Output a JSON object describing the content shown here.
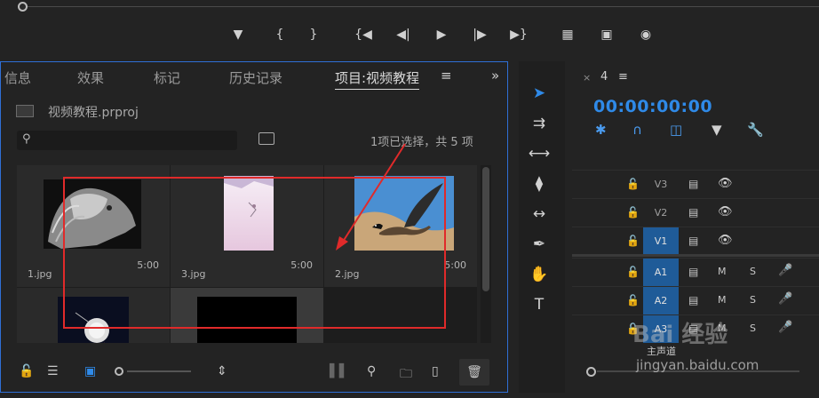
{
  "project_panel": {
    "tabs": [
      {
        "label": "信息"
      },
      {
        "label": "效果"
      },
      {
        "label": "标记"
      },
      {
        "label": "历史记录"
      },
      {
        "label": "项目:视频教程"
      }
    ],
    "project_file": "视频教程.prproj",
    "search_placeholder": "",
    "selection_status": "1项已选择，共 5 项",
    "items": [
      {
        "name": "1.jpg",
        "duration": "5:00"
      },
      {
        "name": "3.jpg",
        "duration": "5:00"
      },
      {
        "name": "2.jpg",
        "duration": "5:00"
      },
      {
        "name": "",
        "duration": ""
      },
      {
        "name": "",
        "duration": ""
      }
    ]
  },
  "timeline": {
    "sequence_name": "4",
    "timecode": "00:00:00:00",
    "video_tracks": [
      "V3",
      "V2",
      "V1"
    ],
    "audio_tracks": [
      "A1",
      "A2",
      "A3"
    ],
    "audio_mute": "M",
    "audio_solo": "S",
    "master_label": "主声道"
  },
  "watermark": {
    "brand": "Bai 经验",
    "url": "jingyan.baidu.com"
  },
  "colors": {
    "accent": "#2f8ae8",
    "selection_border": "#2f6fd6",
    "annotation_red": "#e02a2a",
    "track_active": "#1f5b98"
  }
}
